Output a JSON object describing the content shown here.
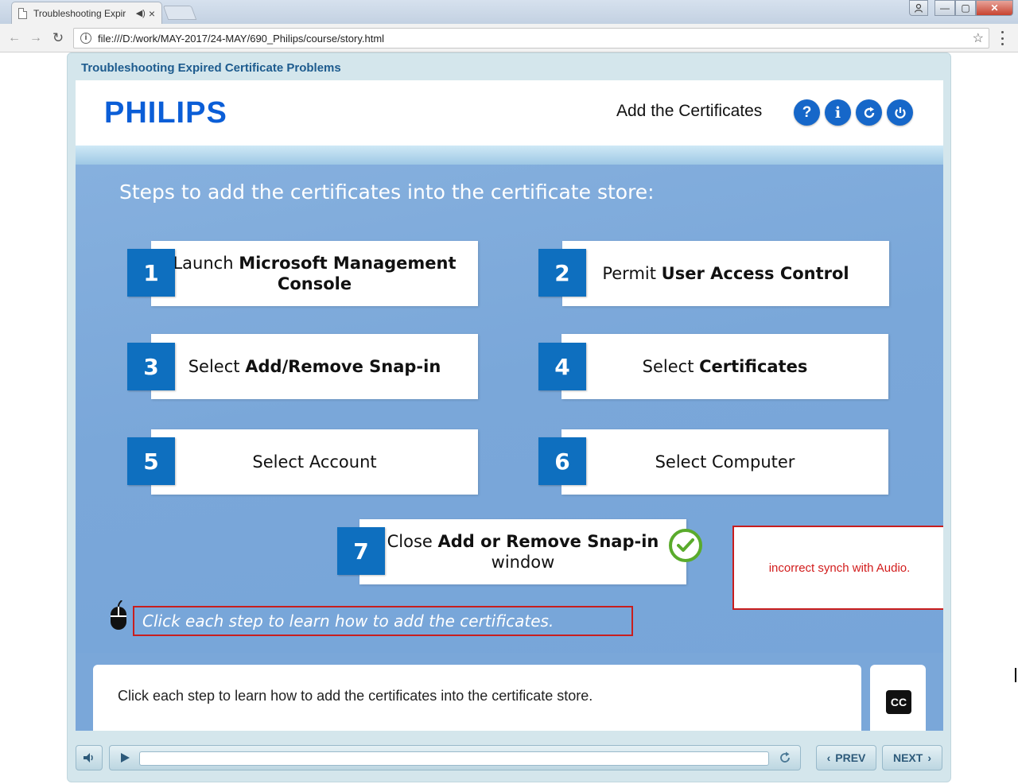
{
  "browser": {
    "tab_title": "Troubleshooting Expir",
    "audio_icon": "◀)",
    "close_icon": "×",
    "url": "file:///D:/work/MAY-2017/24-MAY/690_Philips/course/story.html",
    "window_controls": {
      "minimize": "—",
      "maximize": "▢",
      "close": "✕"
    }
  },
  "course": {
    "title": "Troubleshooting Expired Certificate Problems"
  },
  "header": {
    "logo_text": "PHILIPS",
    "slide_title": "Add the Certificates",
    "help_label": "?",
    "info_label": "i"
  },
  "body": {
    "heading": "Steps to add the certificates into the certificate store:",
    "steps": [
      {
        "number": "1",
        "text_pre": "Launch ",
        "text_bold": "Microsoft Management Console",
        "text_post": ""
      },
      {
        "number": "2",
        "text_pre": "Permit ",
        "text_bold": "User Access Control",
        "text_post": ""
      },
      {
        "number": "3",
        "text_pre": "Select ",
        "text_bold": "Add/Remove Snap-in",
        "text_post": ""
      },
      {
        "number": "4",
        "text_pre": "Select ",
        "text_bold": "Certificates",
        "text_post": ""
      },
      {
        "number": "5",
        "text_pre": "Select Account",
        "text_bold": "",
        "text_post": ""
      },
      {
        "number": "6",
        "text_pre": "Select Computer",
        "text_bold": "",
        "text_post": ""
      },
      {
        "number": "7",
        "text_pre": "Close ",
        "text_bold": "Add or Remove Snap-in",
        "text_post": " window"
      }
    ],
    "instruction": "Click each step to learn how to add the certificates.",
    "annotation": "incorrect synch with Audio."
  },
  "caption": {
    "text": "Click each step to learn how to add the certificates into the certificate store.",
    "cc_label": "CC"
  },
  "controls": {
    "prev_label": "PREV",
    "next_label": "NEXT",
    "progress": 0
  },
  "colors": {
    "accent_blue": "#0e6fbf",
    "header_button": "#1667c9",
    "logo": "#0b5ed7",
    "annotation_red": "#c81e1e",
    "check_green": "#5aab2c"
  }
}
